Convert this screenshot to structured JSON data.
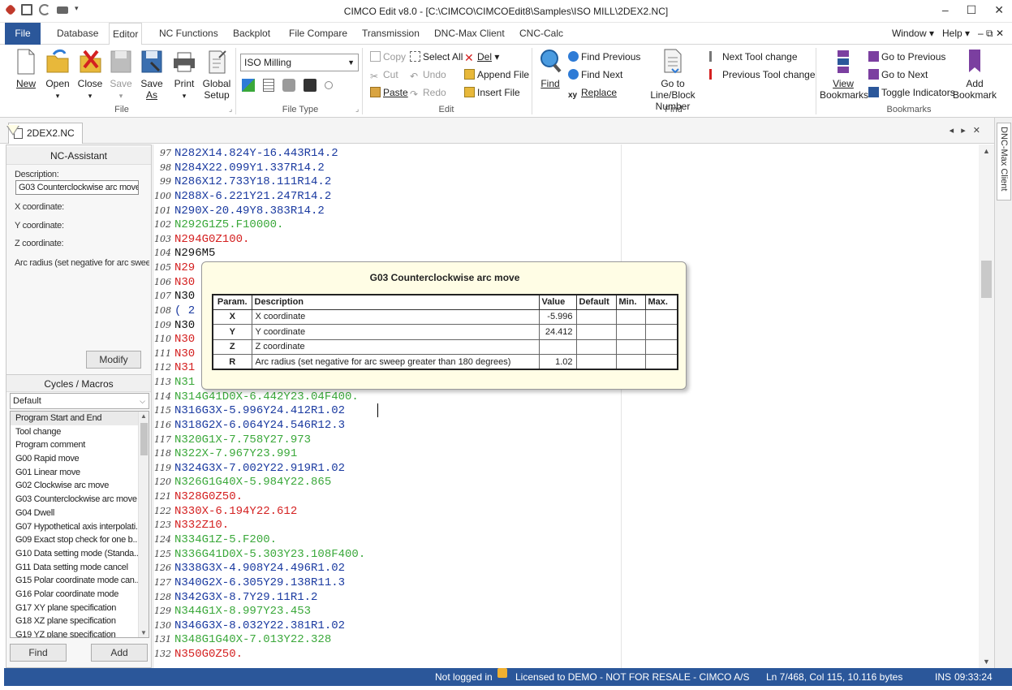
{
  "window": {
    "title": "CIMCO Edit v8.0 - [C:\\CIMCO\\CIMCOEdit8\\Samples\\ISO MILL\\2DEX2.NC]",
    "controls": [
      "–",
      "☐",
      "✕"
    ]
  },
  "ribbon_tabs": {
    "file": "File",
    "database": "Database",
    "editor": "Editor",
    "nc_functions": "NC Functions",
    "backplot": "Backplot",
    "file_compare": "File Compare",
    "transmission": "Transmission",
    "dnc_max_client": "DNC-Max Client",
    "cnc_calc": "CNC-Calc",
    "window_menu": "Window",
    "help_menu": "Help"
  },
  "ribbon": {
    "file_group": {
      "label": "File",
      "new": "New",
      "open": "Open",
      "close": "Close",
      "save": "Save",
      "save_as_1": "Save",
      "save_as_2": "As",
      "print": "Print",
      "global_setup_1": "Global",
      "global_setup_2": "Setup"
    },
    "file_type_group": {
      "label": "File Type",
      "selected": "ISO Milling"
    },
    "edit_group": {
      "label": "Edit",
      "copy": "Copy",
      "cut": "Cut",
      "paste": "Paste",
      "select_all": "Select All",
      "undo": "Undo",
      "redo": "Redo",
      "del": "Del",
      "append_file": "Append File",
      "insert_file": "Insert File"
    },
    "find_group": {
      "label": "Find",
      "find": "Find",
      "find_previous": "Find Previous",
      "find_next": "Find Next",
      "replace": "Replace",
      "goto_line_1": "Go to Line/Block",
      "goto_line_2": "Number",
      "next_tool_change": "Next Tool change",
      "previous_tool_change": "Previous Tool change"
    },
    "bookmarks_group": {
      "label": "Bookmarks",
      "view_1": "View",
      "view_2": "Bookmarks",
      "go_previous": "Go to Previous",
      "go_next": "Go to Next",
      "toggle_indicators": "Toggle Indicators",
      "add_1": "Add",
      "add_2": "Bookmark"
    }
  },
  "doc_tab": {
    "name": "2DEX2.NC",
    "nav": "◂ ▸ ✕"
  },
  "dock_right": {
    "label": "DNC-Max Client"
  },
  "nc_assistant": {
    "title": "NC-Assistant",
    "description_label": "Description:",
    "description_value": "G03 Counterclockwise arc move",
    "x_label": "X coordinate:",
    "y_label": "Y coordinate:",
    "z_label": "Z coordinate:",
    "r_label": "Arc radius (set negative for arc sweep",
    "modify": "Modify"
  },
  "cycles": {
    "title": "Cycles / Macros",
    "selected": "Default",
    "items": [
      "Program Start and End",
      "Tool change",
      "Program comment",
      "G00 Rapid move",
      "G01 Linear move",
      "G02 Clockwise arc move",
      "G03 Counterclockwise arc move",
      "G04 Dwell",
      "G07 Hypothetical axis interpolati...",
      "G09 Exact stop check for one b...",
      "G10 Data setting mode (Standa...",
      "G11 Data setting mode cancel",
      "G15 Polar coordinate mode can...",
      "G16 Polar coordinate mode",
      "G17 XY plane specification",
      "G18 XZ plane specification",
      "G19 YZ plane specification"
    ],
    "find": "Find",
    "add": "Add"
  },
  "code_lines": [
    {
      "n": "97",
      "text": "N282X14.824Y-16.443R14.2",
      "color": "blue"
    },
    {
      "n": "98",
      "text": "N284X22.099Y1.337R14.2",
      "color": "blue"
    },
    {
      "n": "99",
      "text": "N286X12.733Y18.111R14.2",
      "color": "blue"
    },
    {
      "n": "100",
      "text": "N288X-6.221Y21.247R14.2",
      "color": "blue"
    },
    {
      "n": "101",
      "text": "N290X-20.49Y8.383R14.2",
      "color": "blue"
    },
    {
      "n": "102",
      "text": "N292G1Z5.F10000.",
      "color": "green"
    },
    {
      "n": "103",
      "text": "N294G0Z100.",
      "color": "red"
    },
    {
      "n": "104",
      "text": "N296M5",
      "color": "black"
    },
    {
      "n": "105",
      "text": "N29",
      "color": "red"
    },
    {
      "n": "106",
      "text": "N30",
      "color": "red"
    },
    {
      "n": "107",
      "text": "N30",
      "color": "black"
    },
    {
      "n": "108",
      "text": "( 2",
      "color": "blue"
    },
    {
      "n": "109",
      "text": "N30",
      "color": "black"
    },
    {
      "n": "110",
      "text": "N30",
      "color": "red"
    },
    {
      "n": "111",
      "text": "N30",
      "color": "red"
    },
    {
      "n": "112",
      "text": "N31",
      "color": "red"
    },
    {
      "n": "113",
      "text": "N31",
      "color": "green"
    },
    {
      "n": "114",
      "text": "N314G41D0X-6.442Y23.04F400.",
      "color": "green"
    },
    {
      "n": "115",
      "text": "N316G3X-5.996Y24.412R1.02",
      "color": "blue"
    },
    {
      "n": "116",
      "text": "N318G2X-6.064Y24.546R12.3",
      "color": "blue"
    },
    {
      "n": "117",
      "text": "N320G1X-7.758Y27.973",
      "color": "green"
    },
    {
      "n": "118",
      "text": "N322X-7.967Y23.991",
      "color": "green"
    },
    {
      "n": "119",
      "text": "N324G3X-7.002Y22.919R1.02",
      "color": "blue"
    },
    {
      "n": "120",
      "text": "N326G1G40X-5.984Y22.865",
      "color": "green"
    },
    {
      "n": "121",
      "text": "N328G0Z50.",
      "color": "red"
    },
    {
      "n": "122",
      "text": "N330X-6.194Y22.612",
      "color": "red"
    },
    {
      "n": "123",
      "text": "N332Z10.",
      "color": "red"
    },
    {
      "n": "124",
      "text": "N334G1Z-5.F200.",
      "color": "green"
    },
    {
      "n": "125",
      "text": "N336G41D0X-5.303Y23.108F400.",
      "color": "green"
    },
    {
      "n": "126",
      "text": "N338G3X-4.908Y24.496R1.02",
      "color": "blue"
    },
    {
      "n": "127",
      "text": "N340G2X-6.305Y29.138R11.3",
      "color": "blue"
    },
    {
      "n": "128",
      "text": "N342G3X-8.7Y29.11R1.2",
      "color": "blue"
    },
    {
      "n": "129",
      "text": "N344G1X-8.997Y23.453",
      "color": "green"
    },
    {
      "n": "130",
      "text": "N346G3X-8.032Y22.381R1.02",
      "color": "blue"
    },
    {
      "n": "131",
      "text": "N348G1G40X-7.013Y22.328",
      "color": "green"
    },
    {
      "n": "132",
      "text": "N350G0Z50.",
      "color": "red"
    }
  ],
  "colors": {
    "blue": "#1a3aa0",
    "green": "#3aa83a",
    "red": "#d42020",
    "black": "#111111",
    "accent": "#2b579a",
    "tooltip_bg": "#fffde5"
  },
  "tooltip": {
    "title": "G03 Counterclockwise arc move",
    "headers": [
      "Param.",
      "Description",
      "Value",
      "Default",
      "Min.",
      "Max."
    ],
    "rows": [
      {
        "param": "X",
        "desc": "X coordinate",
        "value": "-5.996",
        "default": "",
        "min": "",
        "max": ""
      },
      {
        "param": "Y",
        "desc": "Y coordinate",
        "value": "24.412",
        "default": "",
        "min": "",
        "max": ""
      },
      {
        "param": "Z",
        "desc": "Z coordinate",
        "value": "",
        "default": "",
        "min": "",
        "max": ""
      },
      {
        "param": "R",
        "desc": "Arc radius (set negative for arc sweep greater than 180 degrees)",
        "value": "1.02",
        "default": "",
        "min": "",
        "max": ""
      }
    ]
  },
  "status": {
    "login": "Not logged in",
    "license": "Licensed to DEMO - NOT FOR RESALE - CIMCO A/S",
    "position": "Ln 7/468, Col 115, 10.116 bytes",
    "mode": "INS",
    "time": "09:33:24"
  }
}
